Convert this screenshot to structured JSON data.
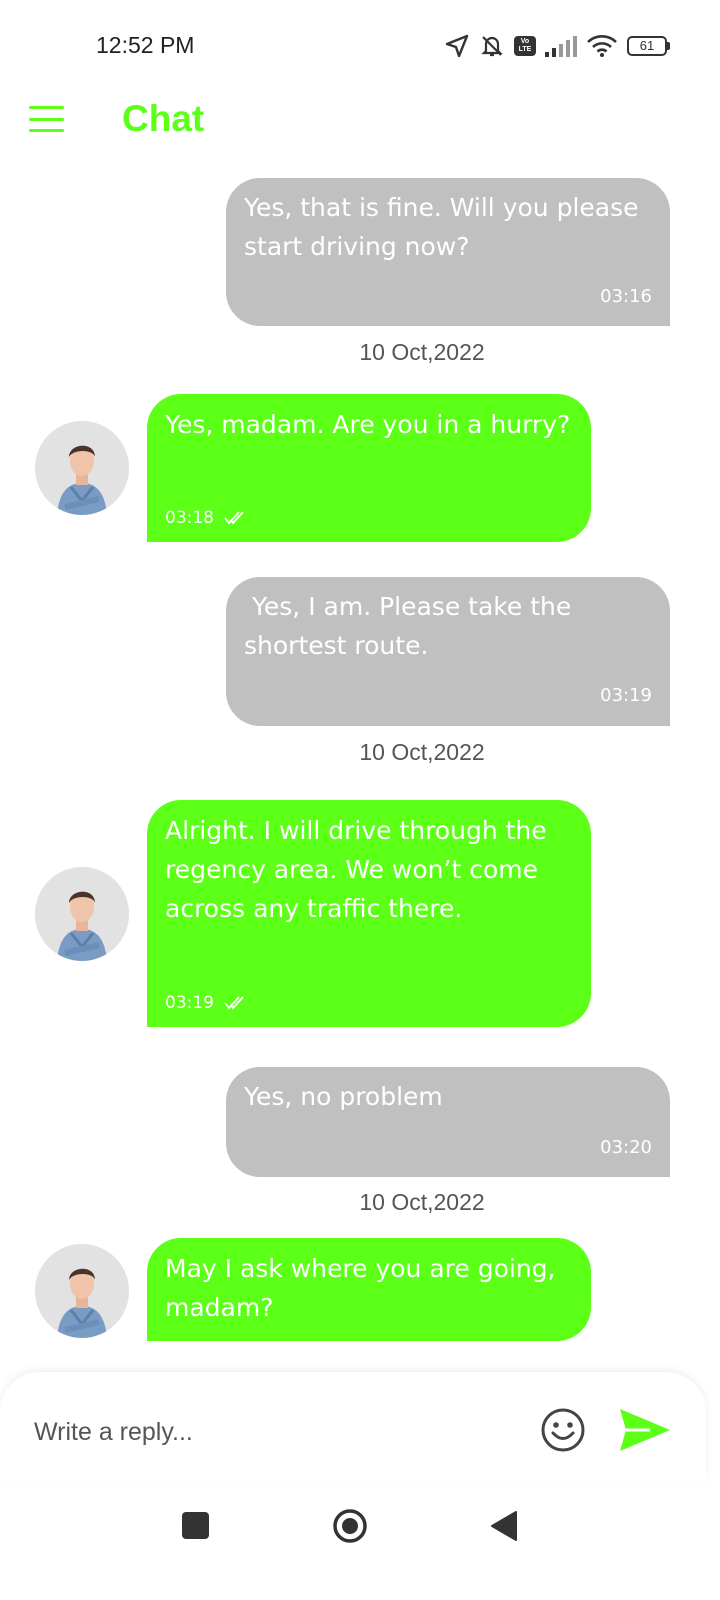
{
  "status_bar": {
    "time": "12:52 PM",
    "volte_line1": "Vo",
    "volte_line2": "LTE",
    "battery": "61"
  },
  "header": {
    "title": "Chat",
    "menu_icon": "hamburger-menu-icon"
  },
  "messages": [
    {
      "type": "sent",
      "text": "Yes, that is fine. Will you please start driving now?",
      "time": "03:16",
      "date": "10 Oct,2022"
    },
    {
      "type": "received",
      "text": "Yes, madam. Are you in a hurry?",
      "time": "03:18"
    },
    {
      "type": "sent",
      "text": " Yes, I am. Please take the shortest route.",
      "time": "03:19",
      "date": "10 Oct,2022"
    },
    {
      "type": "received",
      "text": "Alright. I will drive through the regency area. We won’t come across any traffic there.",
      "time": "03:19"
    },
    {
      "type": "sent",
      "text": "Yes, no problem",
      "time": "03:20",
      "date": "10 Oct,2022"
    },
    {
      "type": "received",
      "text": "May I ask where you are going, madam?"
    }
  ],
  "composer": {
    "placeholder": "Write a reply...",
    "emoji_icon": "emoji-icon",
    "send_icon": "send-icon"
  },
  "colors": {
    "accent": "#5cff16",
    "sent_bubble": "#c1c0c1",
    "text_on_bubble": "#ffffff"
  }
}
